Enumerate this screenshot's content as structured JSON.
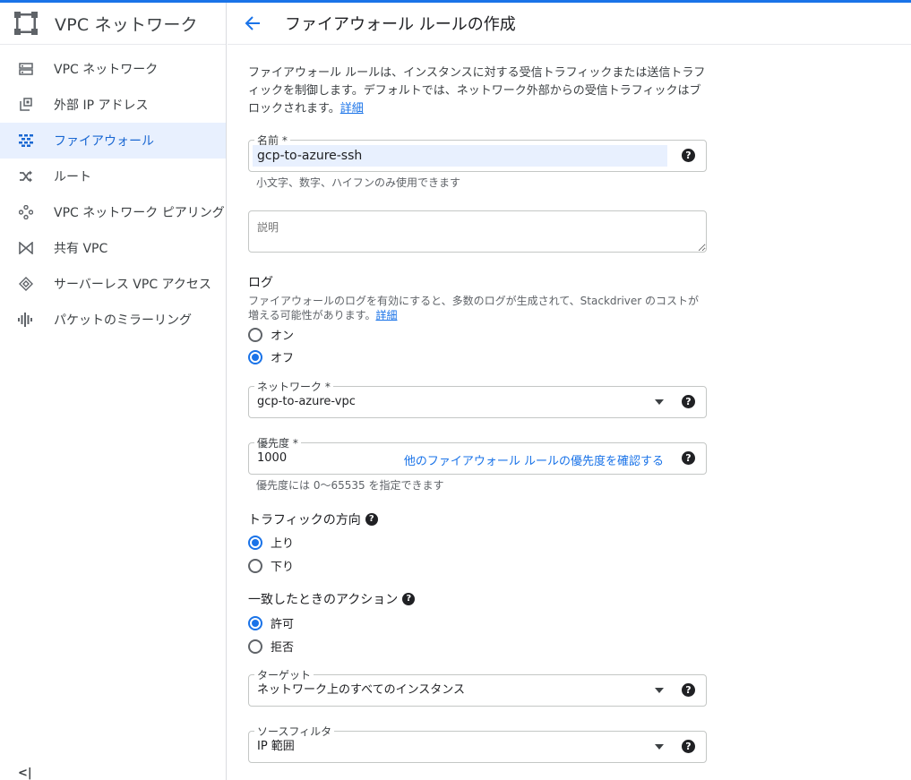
{
  "sidebar": {
    "title": "VPC ネットワーク",
    "items": [
      {
        "label": "VPC ネットワーク"
      },
      {
        "label": "外部 IP アドレス"
      },
      {
        "label": "ファイアウォール"
      },
      {
        "label": "ルート"
      },
      {
        "label": "VPC ネットワーク ピアリング"
      },
      {
        "label": "共有 VPC"
      },
      {
        "label": "サーバーレス VPC アクセス"
      },
      {
        "label": "パケットのミラーリング"
      }
    ],
    "collapse_label": "<|"
  },
  "header": {
    "title": "ファイアウォール ルールの作成"
  },
  "intro": {
    "text": "ファイアウォール ルールは、インスタンスに対する受信トラフィックまたは送信トラフィックを制御します。デフォルトでは、ネットワーク外部からの受信トラフィックはブロックされます。",
    "link": "詳細"
  },
  "name_field": {
    "label": "名前 *",
    "value": "gcp-to-azure-ssh",
    "hint": "小文字、数字、ハイフンのみ使用できます"
  },
  "description_field": {
    "placeholder": "説明"
  },
  "logs": {
    "title": "ログ",
    "desc": "ファイアウォールのログを有効にすると、多数のログが生成されて、Stackdriver のコストが増える可能性があります。",
    "link": "詳細",
    "on_label": "オン",
    "off_label": "オフ"
  },
  "network_field": {
    "label": "ネットワーク *",
    "value": "gcp-to-azure-vpc"
  },
  "priority_field": {
    "label": "優先度 *",
    "value": "1000",
    "link": "他のファイアウォール ルールの優先度を確認する",
    "hint": "優先度には 0～65535 を指定できます"
  },
  "direction": {
    "title": "トラフィックの方向",
    "ingress_label": "上り",
    "egress_label": "下り"
  },
  "action": {
    "title": "一致したときのアクション",
    "allow_label": "許可",
    "deny_label": "拒否"
  },
  "target_field": {
    "label": "ターゲット",
    "value": "ネットワーク上のすべてのインスタンス"
  },
  "source_filter_field": {
    "label": "ソースフィルタ",
    "value": "IP 範囲"
  },
  "help_glyph": "?"
}
